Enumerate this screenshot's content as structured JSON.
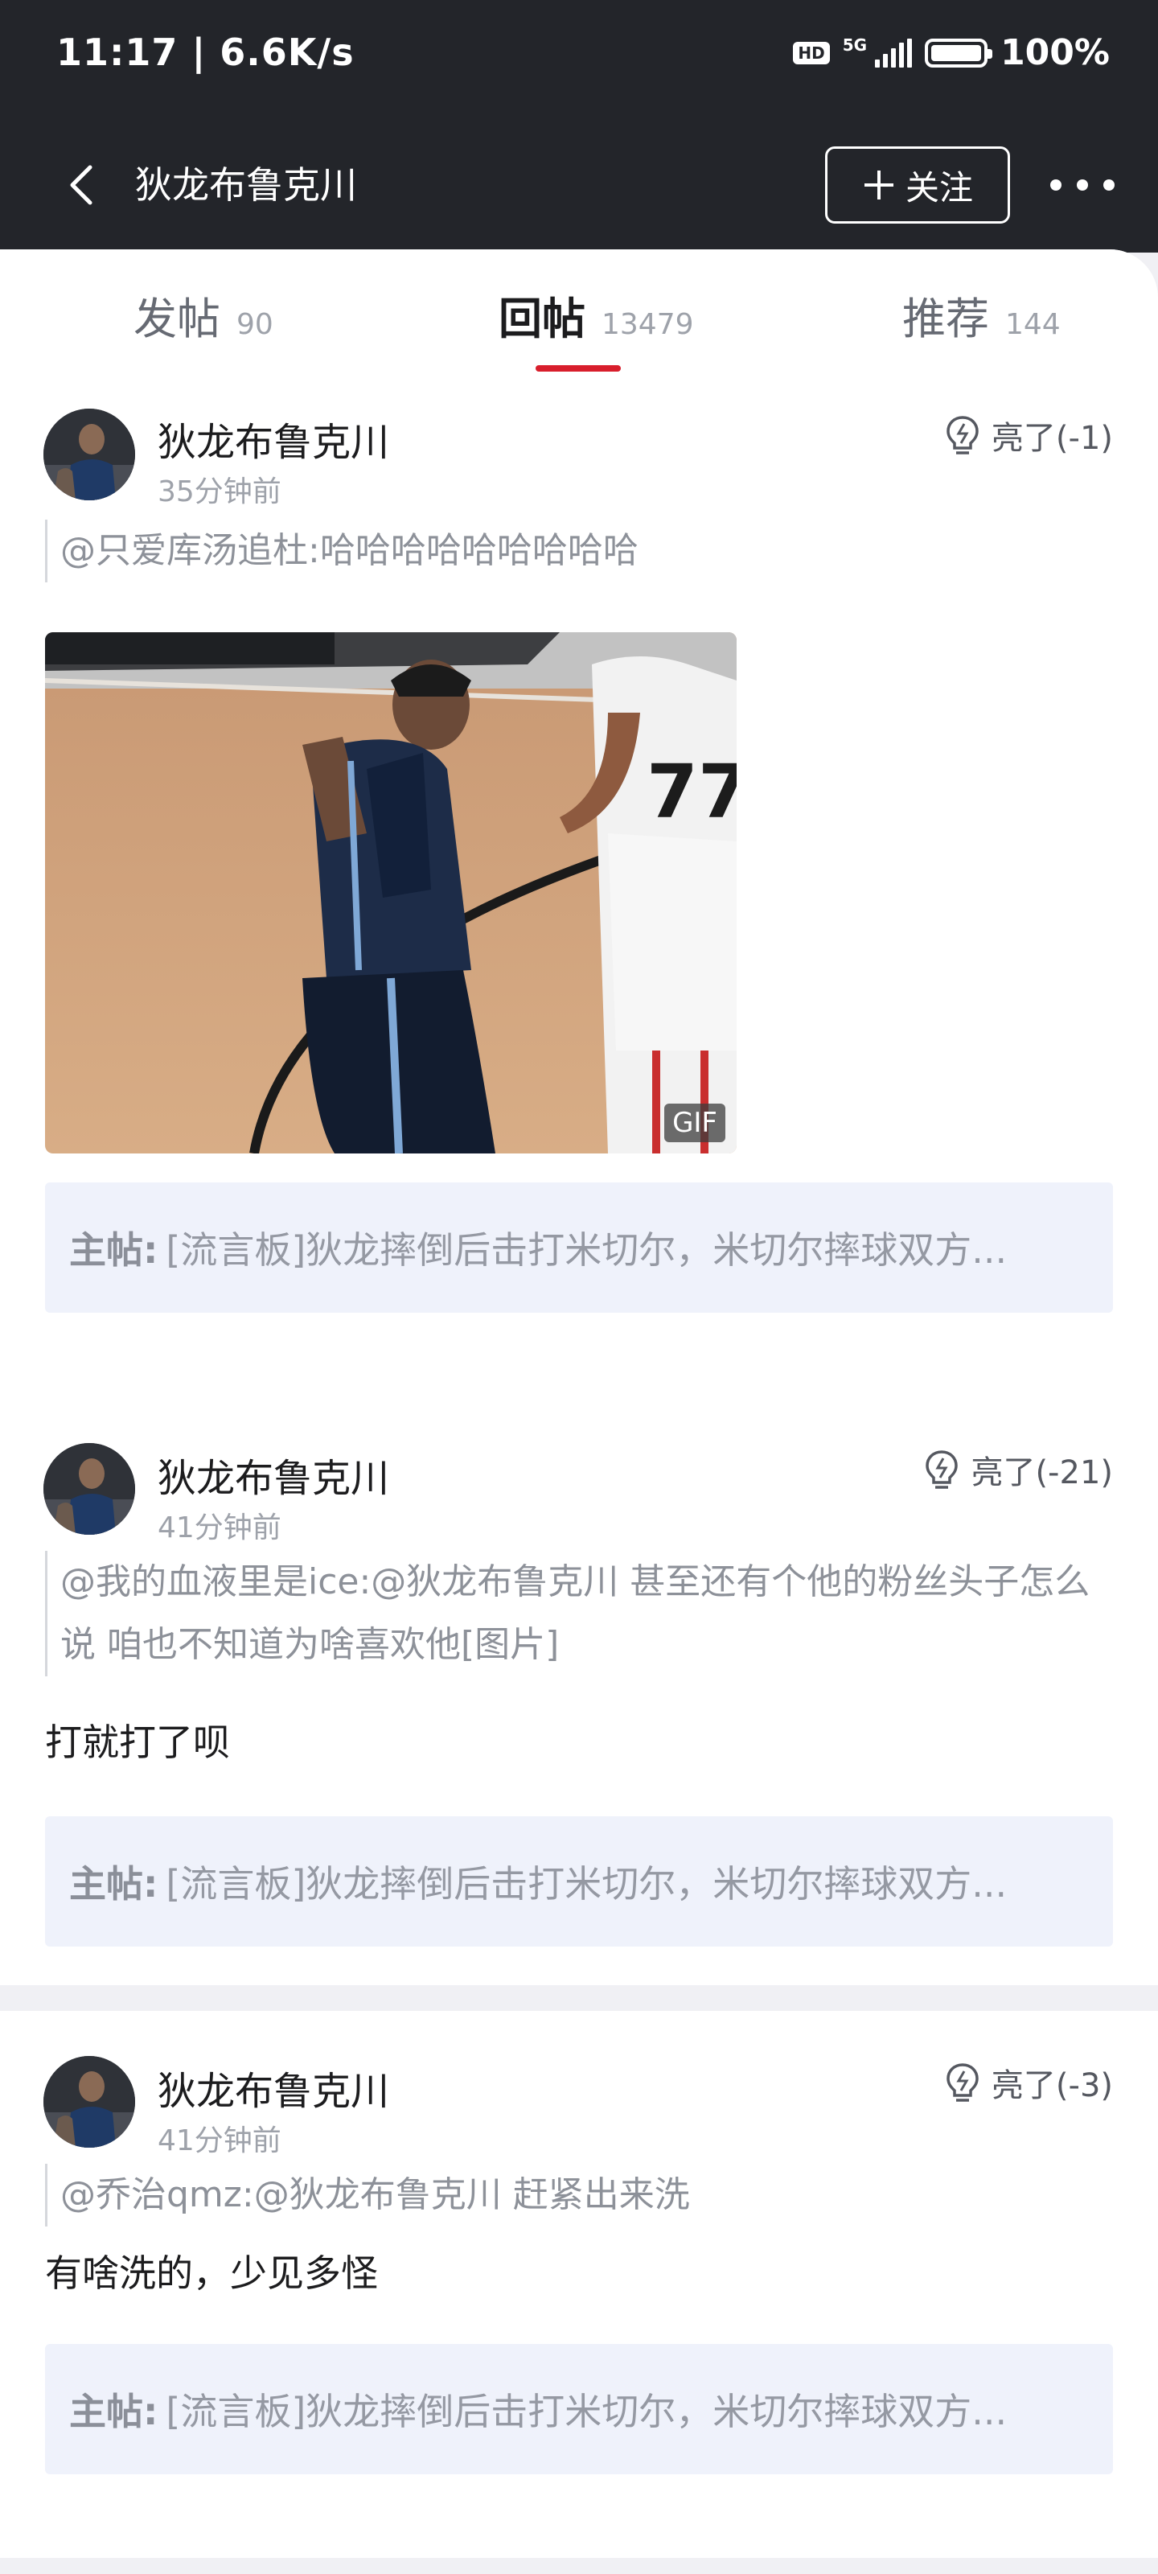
{
  "status_bar": {
    "time": "11:17 | 6.6K/s",
    "hd": "HD",
    "network": "5G",
    "battery": "100%"
  },
  "nav": {
    "title": "狄龙布鲁克川",
    "follow_label": "关注"
  },
  "tabs": [
    {
      "label": "发帖",
      "count": "90",
      "active": false
    },
    {
      "label": "回帖",
      "count": "13479",
      "active": true
    },
    {
      "label": "推荐",
      "count": "144",
      "active": false
    }
  ],
  "posts": [
    {
      "username": "狄龙布鲁克川",
      "time": "35分钟前",
      "light": "亮了(-1)",
      "quote": "@只爱库汤追杜:哈哈哈哈哈哈哈哈哈",
      "body": "",
      "media_badge": "GIF",
      "main_post_prefix": "主帖:",
      "main_post_text": "[流言板]狄龙摔倒后击打米切尔，米切尔摔球双方..."
    },
    {
      "username": "狄龙布鲁克川",
      "time": "41分钟前",
      "light": "亮了(-21)",
      "quote": "@我的血液里是ice:@狄龙布鲁克川  甚至还有个他的粉丝头子怎么说  咱也不知道为啥喜欢他[图片]",
      "body": "打就打了呗",
      "main_post_prefix": "主帖:",
      "main_post_text": "[流言板]狄龙摔倒后击打米切尔，米切尔摔球双方..."
    },
    {
      "username": "狄龙布鲁克川",
      "time": "41分钟前",
      "light": "亮了(-3)",
      "quote": "@乔治qmz:@狄龙布鲁克川 赶紧出来洗",
      "body": "有啥洗的，少见多怪",
      "main_post_prefix": "主帖:",
      "main_post_text": "[流言板]狄龙摔倒后击打米切尔，米切尔摔球双方..."
    }
  ],
  "colors": {
    "header_bg": "#23252a",
    "accent": "#d81e2c",
    "mainpost_bg": "#eff2fb"
  }
}
